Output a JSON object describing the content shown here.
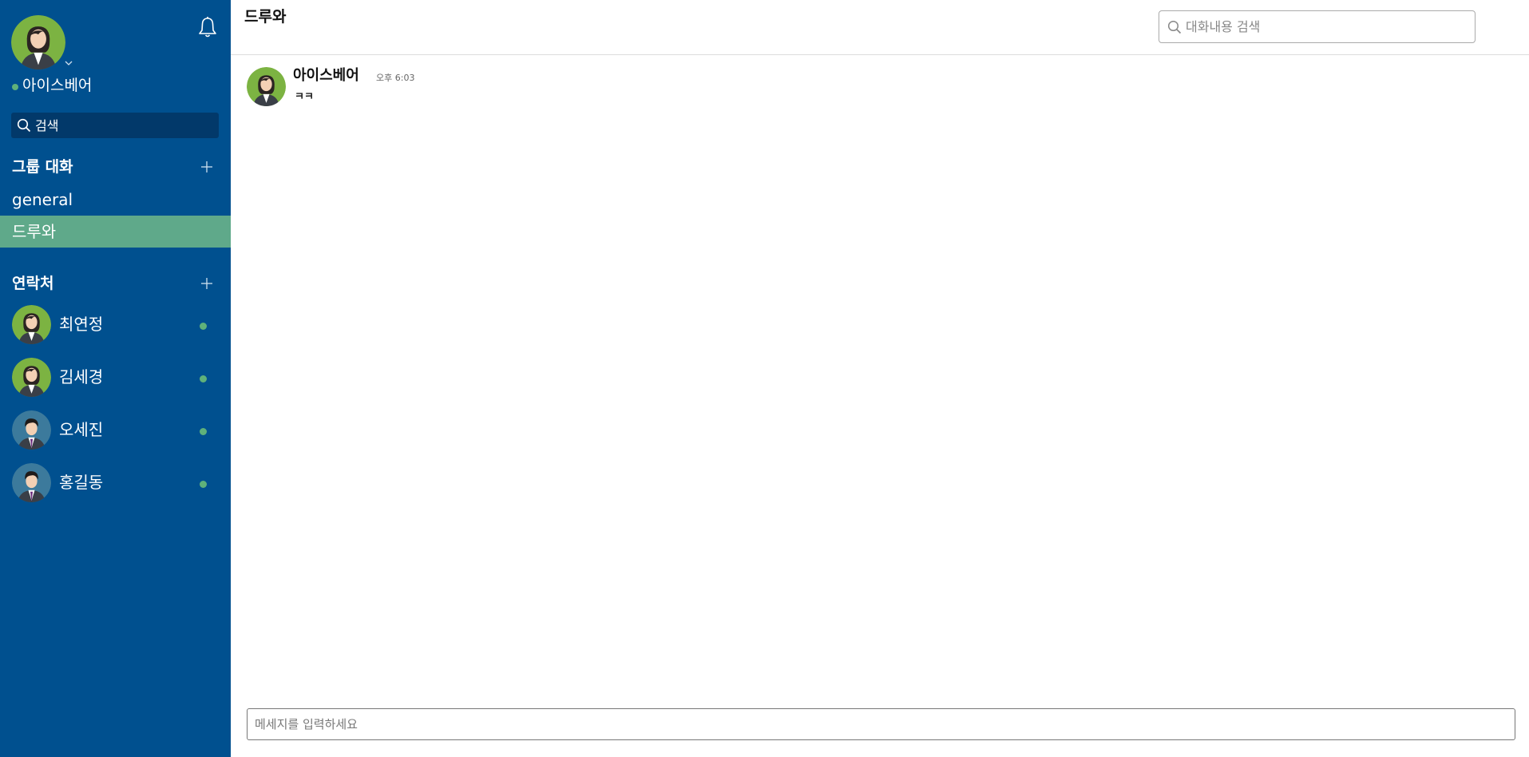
{
  "colors": {
    "sidebar_bg": "#00508f",
    "sidebar_search_bg": "#02396a",
    "active_item_bg": "#5fa98a",
    "online": "#5fb17a",
    "avatar_female_bg": "#7cb342",
    "avatar_male_bg": "#3c7a9c"
  },
  "user": {
    "name": "아이스베어",
    "status": "online",
    "avatar": "female-avatar"
  },
  "sidebar": {
    "search_placeholder": "검색",
    "groups": {
      "title": "그룹 대화",
      "add_icon": "plus-icon",
      "items": [
        {
          "label": "general",
          "active": false
        },
        {
          "label": "드루와",
          "active": true
        }
      ]
    },
    "contacts": {
      "title": "연락처",
      "add_icon": "plus-icon",
      "items": [
        {
          "name": "최연정",
          "avatar": "female-avatar",
          "status": "online"
        },
        {
          "name": "김세경",
          "avatar": "female-avatar",
          "status": "online"
        },
        {
          "name": "오세진",
          "avatar": "male-avatar",
          "status": "online"
        },
        {
          "name": "홍길동",
          "avatar": "male-avatar",
          "status": "online"
        }
      ]
    }
  },
  "channel": {
    "title": "드루와",
    "search_placeholder": "대화내용 검색"
  },
  "messages": [
    {
      "author": "아이스베어",
      "time": "오후 6:03",
      "text": "ㅋㅋ",
      "avatar": "female-avatar"
    }
  ],
  "composer": {
    "placeholder": "메세지를 입력하세요"
  }
}
